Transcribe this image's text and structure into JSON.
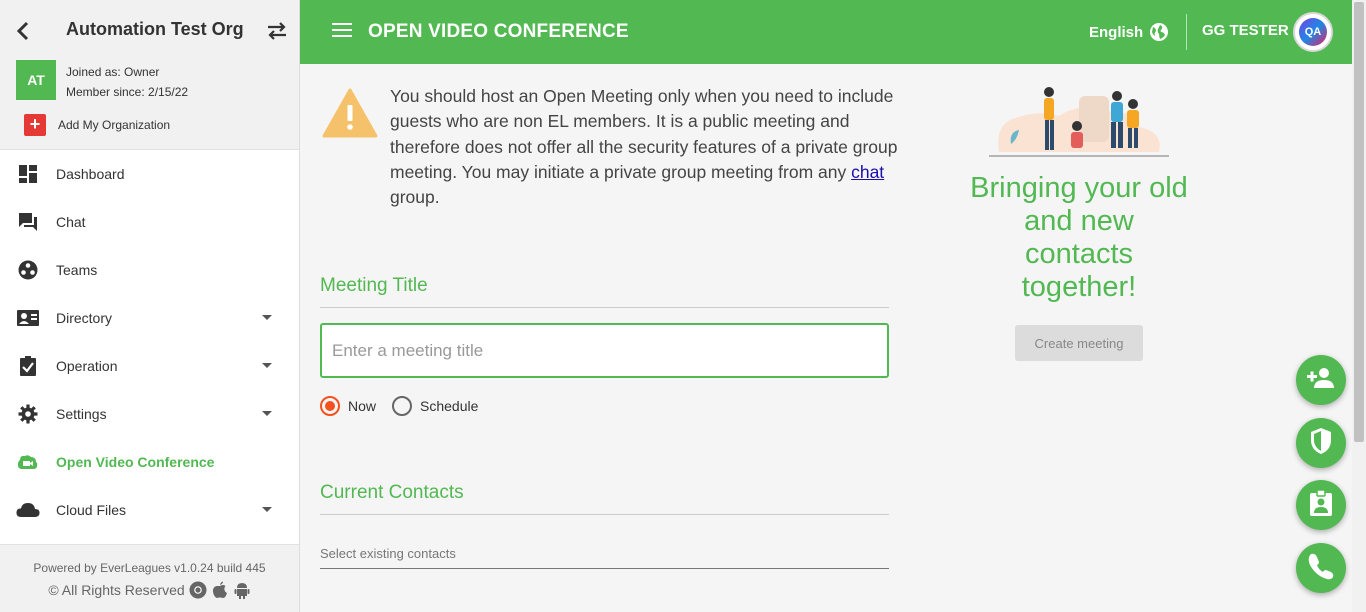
{
  "sidebar": {
    "org_name": "Automation Test Org",
    "avatar_initials": "AT",
    "joined_as": "Joined as: Owner",
    "member_since": "Member since: 2/15/22",
    "add_org_label": "Add My Organization",
    "items": [
      {
        "label": "Dashboard",
        "icon": "dashboard-icon"
      },
      {
        "label": "Chat",
        "icon": "chat-icon"
      },
      {
        "label": "Teams",
        "icon": "teams-icon"
      },
      {
        "label": "Directory",
        "icon": "directory-icon",
        "expandable": true
      },
      {
        "label": "Operation",
        "icon": "operation-icon",
        "expandable": true
      },
      {
        "label": "Settings",
        "icon": "gear-icon",
        "expandable": true
      },
      {
        "label": "Open Video Conference",
        "icon": "video-icon",
        "active": true
      },
      {
        "label": "Cloud Files",
        "icon": "cloud-icon",
        "expandable": true
      }
    ],
    "footer_powered": "Powered by EverLeagues v1.0.24 build 445",
    "footer_rights": "© All Rights Reserved"
  },
  "header": {
    "title": "OPEN VIDEO CONFERENCE",
    "language": "English",
    "user_name": "GG TESTER",
    "avatar_text": "QA"
  },
  "main": {
    "warning_before_link": "You should host an Open Meeting only when you need to include guests who are non EL members. It is a public meeting and therefore does not offer all the security features of a private group meeting. You may initiate a private group meeting from any ",
    "warning_link": "chat",
    "warning_after_link": " group.",
    "meeting_title_heading": "Meeting Title",
    "meeting_title_placeholder": "Enter a meeting title",
    "meeting_title_value": "",
    "radio_now": "Now",
    "radio_schedule": "Schedule",
    "radio_selected": "Now",
    "current_contacts_heading": "Current Contacts",
    "contacts_placeholder": "Select existing contacts",
    "promo_text": "Bringing your old and new contacts together!",
    "create_button": "Create meeting"
  },
  "fabs": [
    "add-contact-icon",
    "shield-icon",
    "contact-badge-icon",
    "phone-icon"
  ],
  "colors": {
    "accent": "#52b852",
    "radio": "#f4511e",
    "warning": "#f5c26b"
  }
}
